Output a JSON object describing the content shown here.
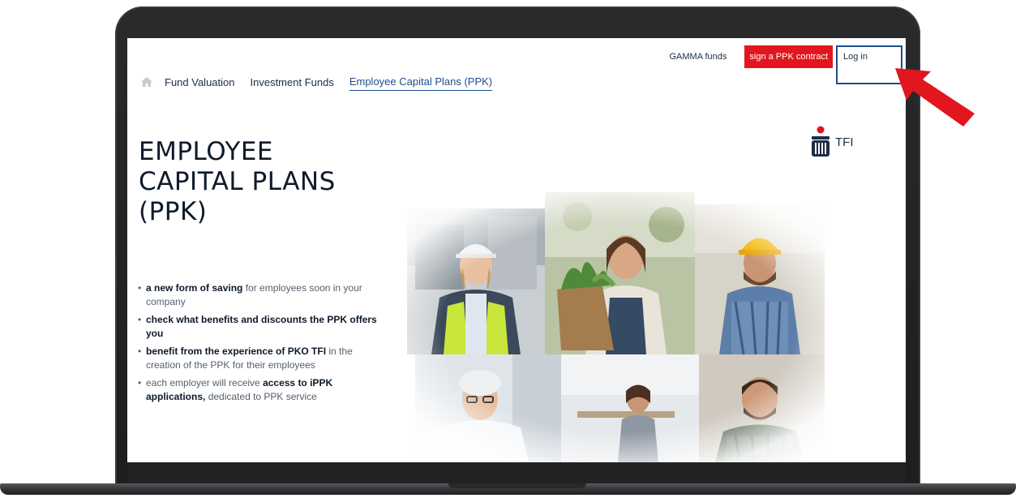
{
  "topbar": {
    "gamma_link": "GAMMA funds",
    "sign_button": "sign a PPK contract",
    "login_button": "Log in"
  },
  "nav": {
    "items": [
      {
        "label": "Fund Valuation"
      },
      {
        "label": "Investment Funds"
      },
      {
        "label": "Employee Capital Plans (PPK)"
      }
    ]
  },
  "logo": {
    "text": "TFI"
  },
  "hero": {
    "title_line1": "EMPLOYEE",
    "title_line2": "CAPITAL PLANS",
    "title_line3": "(PPK)"
  },
  "bullets": [
    {
      "bold": "a new form of saving",
      "rest": " for employees soon in your company"
    },
    {
      "bold": "check what benefits and discounts the PPK offers you",
      "rest": ""
    },
    {
      "bold": "benefit from the experience of PKO TFI",
      "rest": " in the creation of the PPK for their employees"
    },
    {
      "pre": "each employer will receive ",
      "bold": "access to iPPK applications,",
      "rest": " dedicated to PPK service"
    }
  ],
  "colors": {
    "accent_red": "#e1161e",
    "navy": "#1c2d46",
    "highlight_blue": "#1f4e8c"
  },
  "icons": [
    "home-icon",
    "pko-logo-icon",
    "red-arrow-icon"
  ]
}
